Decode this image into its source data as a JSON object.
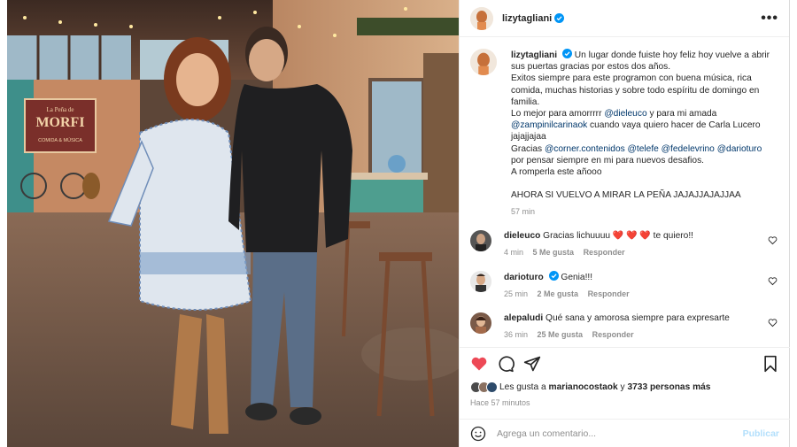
{
  "post": {
    "username": "lizytagliani",
    "more_label": "•••"
  },
  "caption": {
    "username": "lizytagliani",
    "line1": "Un lugar donde fuiste hoy feliz hoy vuelve a abrir sus puertas gracias por estos dos años.",
    "line2": "Exitos siempre para este programon con buena música, rica comida, muchas historias y sobre todo espíritu de domingo en familia.",
    "line3_pre": "Lo mejor para amorrrrr ",
    "line3_mention": "@dieleuco",
    "line3_post": " y para mi amada",
    "line4_mention": "@zampinilcarinaok",
    "line4_post": " cuando vaya quiero hacer de Carla Lucero jajajjajaa",
    "line5_pre": "Gracias ",
    "line5_m1": "@corner.contenidos",
    "line5_m2": "@telefe",
    "line5_m3": "@fedelevrino",
    "line5_m4": "@darioturo",
    "line5_post": "por pensar siempre en mi para nuevos desafios.",
    "line6": "A romperla este añooo",
    "line7": "AHORA SI VUELVO A MIRAR LA PEÑA JAJAJJAJAJJAA",
    "time": "57 min"
  },
  "comments": [
    {
      "username": "dieleuco",
      "verified": false,
      "text": "Gracias lichuuuu",
      "hearts": "❤️ ❤️ ❤️",
      "text_after": "te quiero!!",
      "time": "4 min",
      "likes": "5 Me gusta",
      "reply": "Responder"
    },
    {
      "username": "darioturo",
      "verified": true,
      "text": "Genia!!!",
      "time": "25 min",
      "likes": "2 Me gusta",
      "reply": "Responder"
    },
    {
      "username": "alepaludi",
      "verified": false,
      "text": "Qué sana y amorosa siempre para expresarte",
      "time": "36 min",
      "likes": "25 Me gusta",
      "reply": "Responder"
    }
  ],
  "likes": {
    "prefix": "Les gusta a",
    "user": "marianocostaok",
    "middle": "y",
    "count": "3733 personas más"
  },
  "time_ago": "Hace 57 minutos",
  "add_comment": {
    "placeholder": "Agrega un comentario...",
    "publish": "Publicar"
  },
  "icons": {
    "like": "heart-filled-icon",
    "comment": "comment-icon",
    "share": "send-icon",
    "save": "bookmark-icon",
    "emoji": "emoji-icon",
    "verified": "verified-badge-icon"
  },
  "colors": {
    "like_red": "#ed4956",
    "verified_blue": "#0095f6",
    "link_blue": "#00376b",
    "publish_disabled": "#b2dffc"
  },
  "photo": {
    "sign_line1": "La Peña de",
    "sign_line2": "MORFI",
    "sign_line3": "COMIDA & MÚSICA"
  }
}
